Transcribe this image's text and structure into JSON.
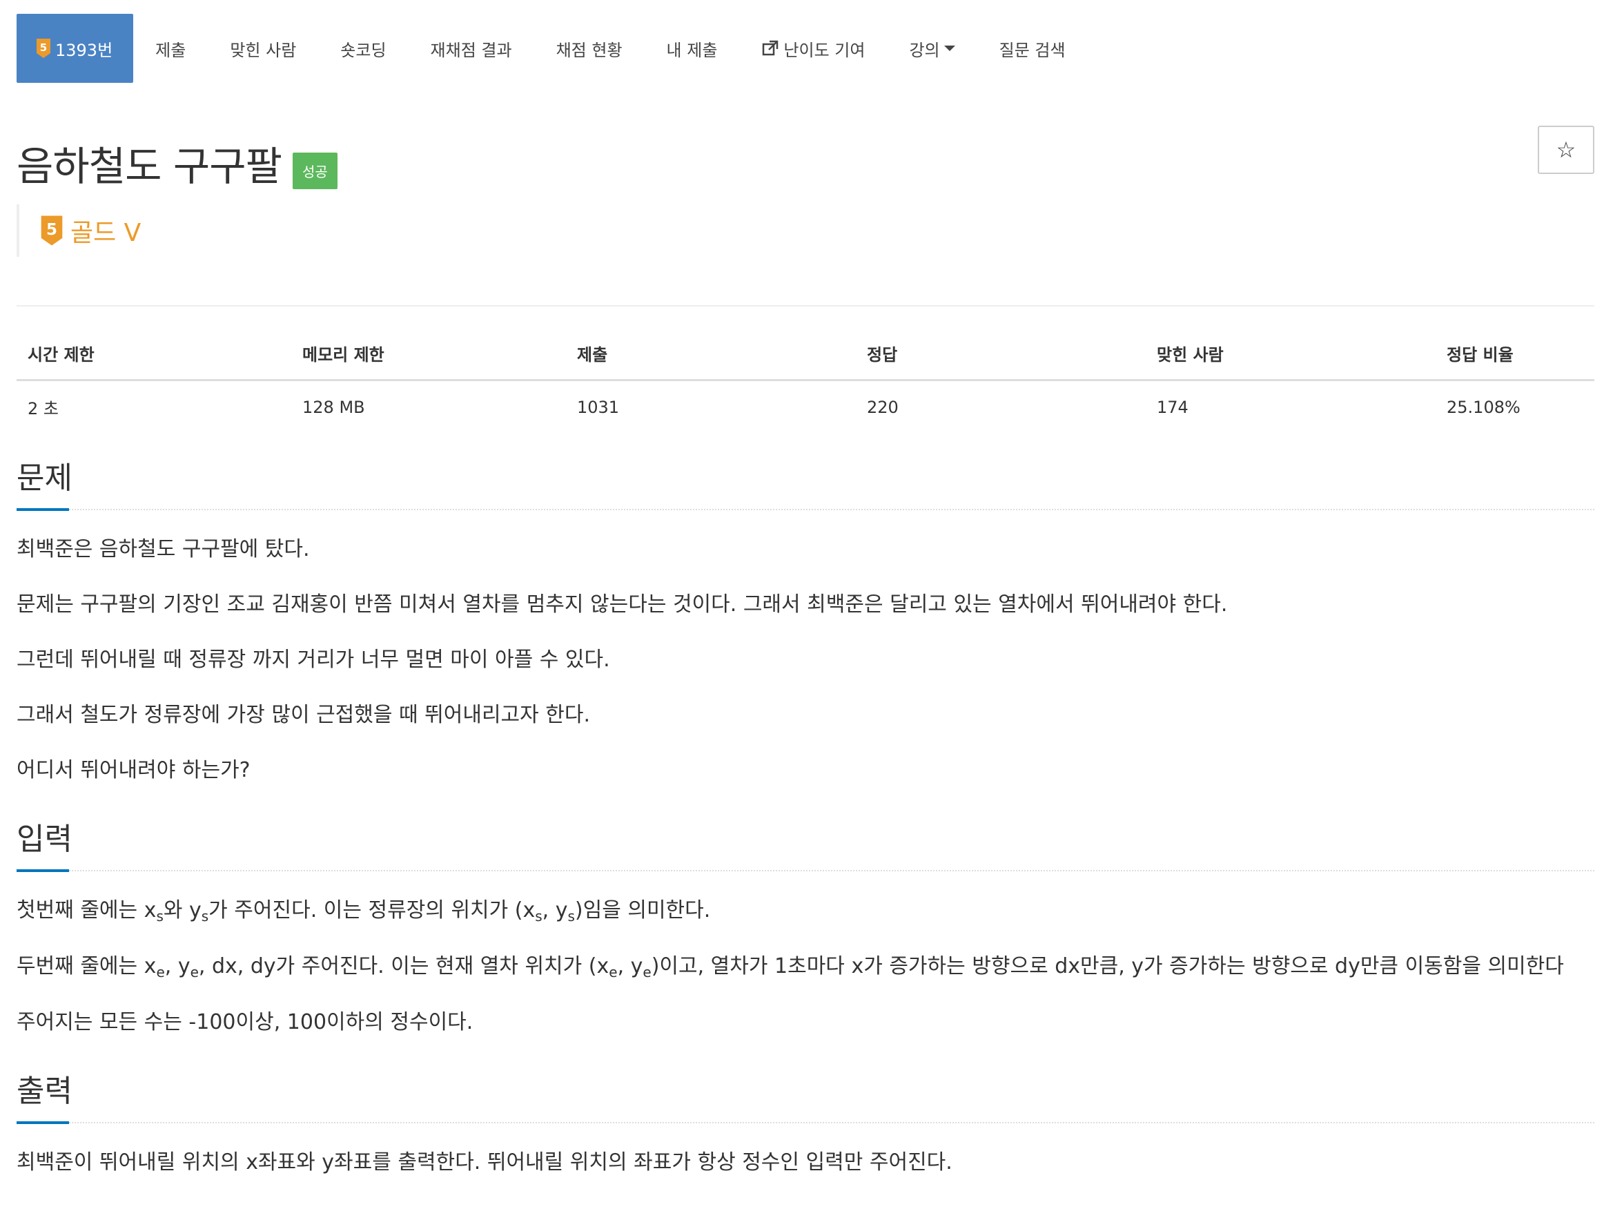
{
  "nav": {
    "items": [
      {
        "label": "1393번",
        "active": true,
        "icon": "tier-5-icon"
      },
      {
        "label": "제출"
      },
      {
        "label": "맞힌 사람"
      },
      {
        "label": "숏코딩"
      },
      {
        "label": "재채점 결과"
      },
      {
        "label": "채점 현황"
      },
      {
        "label": "내 제출"
      },
      {
        "label": "난이도 기여",
        "icon": "external-link-icon"
      },
      {
        "label": "강의",
        "dropdown": true
      },
      {
        "label": "질문 검색"
      }
    ]
  },
  "problem": {
    "title": "음하철도 구구팔",
    "status_badge": "성공",
    "star": "☆",
    "tier_number": "5",
    "tier_label": "골드 V",
    "tier_color": "#ec9a29"
  },
  "info_table": {
    "headers": [
      "시간 제한",
      "메모리 제한",
      "제출",
      "정답",
      "맞힌 사람",
      "정답 비율"
    ],
    "values": [
      "2 초",
      "128 MB",
      "1031",
      "220",
      "174",
      "25.108%"
    ]
  },
  "sections": {
    "problem": {
      "title": "문제",
      "paragraphs": [
        "최백준은 음하철도 구구팔에 탔다.",
        "문제는 구구팔의 기장인 조교 김재홍이 반쯤 미쳐서 열차를 멈추지 않는다는 것이다. 그래서 최백준은 달리고 있는 열차에서 뛰어내려야 한다.",
        "그런데 뛰어내릴 때 정류장 까지 거리가 너무 멀면 마이 아플 수 있다.",
        "그래서 철도가 정류장에 가장 많이 근접했을 때 뛰어내리고자 한다.",
        "어디서 뛰어내려야 하는가?"
      ]
    },
    "input": {
      "title": "입력",
      "line1": {
        "a": "첫번째 줄에는 x",
        "sub1": "s",
        "b": "와 y",
        "sub2": "s",
        "c": "가 주어진다. 이는 정류장의 위치가 (x",
        "sub3": "s",
        "d": ", y",
        "sub4": "s",
        "e": ")임을 의미한다."
      },
      "line2": {
        "a": "두번째 줄에는 x",
        "sub1": "e",
        "b": ", y",
        "sub2": "e",
        "c": ", dx, dy가 주어진다. 이는 현재 열차 위치가 (x",
        "sub3": "e",
        "d": ", y",
        "sub4": "e",
        "e": ")이고, 열차가 1초마다 x가 증가하는 방향으로 dx만큼, y가 증가하는 방향으로 dy만큼 이동함을 의미한다"
      },
      "line3": "주어지는 모든 수는 -100이상, 100이하의 정수이다."
    },
    "output": {
      "title": "출력",
      "paragraphs": [
        "최백준이 뛰어내릴 위치의 x좌표와 y좌표를 출력한다. 뛰어내릴 위치의 좌표가 항상 정수인 입력만 주어진다."
      ]
    }
  },
  "colors": {
    "nav_active": "#4a83c4",
    "badge_success": "#5cb85c",
    "section_underline": "#0076c0",
    "tier_gold": "#ec9a29"
  }
}
